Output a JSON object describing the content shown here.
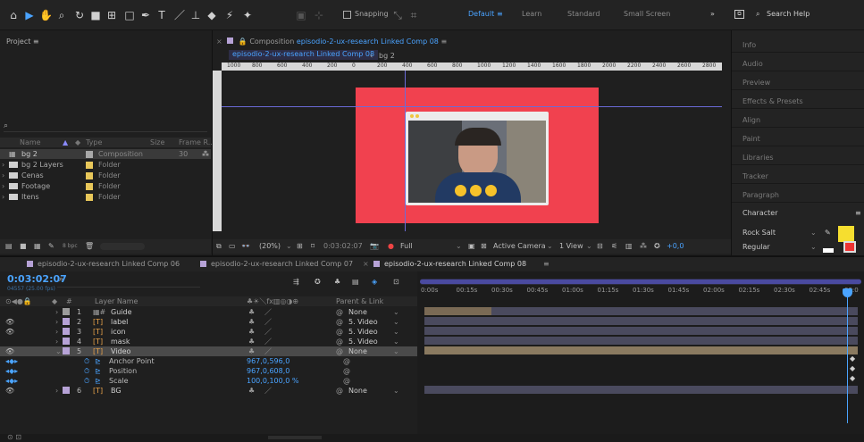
{
  "toolbar": {
    "snapping": "Snapping",
    "workspaces": [
      "Default",
      "Learn",
      "Standard",
      "Small Screen"
    ],
    "active_workspace": "Default",
    "search_placeholder": "Search Help"
  },
  "project": {
    "title": "Project",
    "columns": {
      "name": "Name",
      "type": "Type",
      "size": "Size",
      "frame_rate": "Frame R..."
    },
    "items": [
      {
        "name": "bg 2",
        "type": "Composition",
        "frame_rate": "30",
        "color": "#a8a8a8"
      },
      {
        "name": "bg 2 Layers",
        "type": "Folder",
        "color": "#e8c75a"
      },
      {
        "name": "Cenas",
        "type": "Folder",
        "color": "#e8c75a"
      },
      {
        "name": "Footage",
        "type": "Folder",
        "color": "#e8c75a"
      },
      {
        "name": "Itens",
        "type": "Folder",
        "color": "#e8c75a"
      }
    ],
    "bpc": "8 bpc"
  },
  "viewer": {
    "comp_label": "Composition",
    "comp_name": "episodio-2-ux-research Linked Comp 08",
    "tab_active": "episodio-2-ux-research Linked Comp 08",
    "tab_bg": "bg 2",
    "ruler": [
      "1000",
      "800",
      "600",
      "400",
      "200",
      "0",
      "200",
      "400",
      "600",
      "800",
      "1000",
      "1200",
      "1400",
      "1600",
      "1800",
      "2000",
      "2200",
      "2400",
      "2600",
      "2800"
    ],
    "zoom": "(20%)",
    "timecode": "0:03:02:07",
    "resolution": "Full",
    "camera": "Active Camera",
    "views": "1 View",
    "exposure": "+0,0"
  },
  "right_panel": {
    "items": [
      "Info",
      "Audio",
      "Preview",
      "Effects & Presets",
      "Align",
      "Paint",
      "Libraries",
      "Tracker",
      "Paragraph",
      "Character"
    ],
    "font_name": "Rock Salt",
    "font_style": "Regular"
  },
  "timeline": {
    "tabs": [
      "episodio-2-ux-research Linked Comp 06",
      "episodio-2-ux-research Linked Comp 07",
      "episodio-2-ux-research Linked Comp 08"
    ],
    "active_tab": "episodio-2-ux-research Linked Comp 08",
    "timecode": "0:03:02:07",
    "frames": "04557 (25.00 fps)",
    "col_layer_name": "Layer Name",
    "col_parent": "Parent & Link",
    "ruler": [
      "0:00s",
      "00:15s",
      "00:30s",
      "00:45s",
      "01:00s",
      "01:15s",
      "01:30s",
      "01:45s",
      "02:00s",
      "02:15s",
      "02:30s",
      "02:45s",
      "03:0"
    ],
    "layers": [
      {
        "num": "1",
        "name": "Guide",
        "parent": "None",
        "color": "#9b9b9b"
      },
      {
        "num": "2",
        "name": "label",
        "parent": "5. Video",
        "color": "#b6a2d6"
      },
      {
        "num": "3",
        "name": "icon",
        "parent": "5. Video",
        "color": "#b6a2d6"
      },
      {
        "num": "4",
        "name": "mask",
        "parent": "5. Video",
        "color": "#b6a2d6"
      },
      {
        "num": "5",
        "name": "Video",
        "parent": "None",
        "color": "#b6a2d6"
      }
    ],
    "props": [
      {
        "name": "Anchor Point",
        "value": "967,0,596,0"
      },
      {
        "name": "Position",
        "value": "967,0,608,0"
      },
      {
        "name": "Scale",
        "value": "100,0,100,0 %"
      }
    ],
    "layer6": {
      "num": "6",
      "name": "BG",
      "parent": "None",
      "color": "#b6a2d6"
    }
  }
}
